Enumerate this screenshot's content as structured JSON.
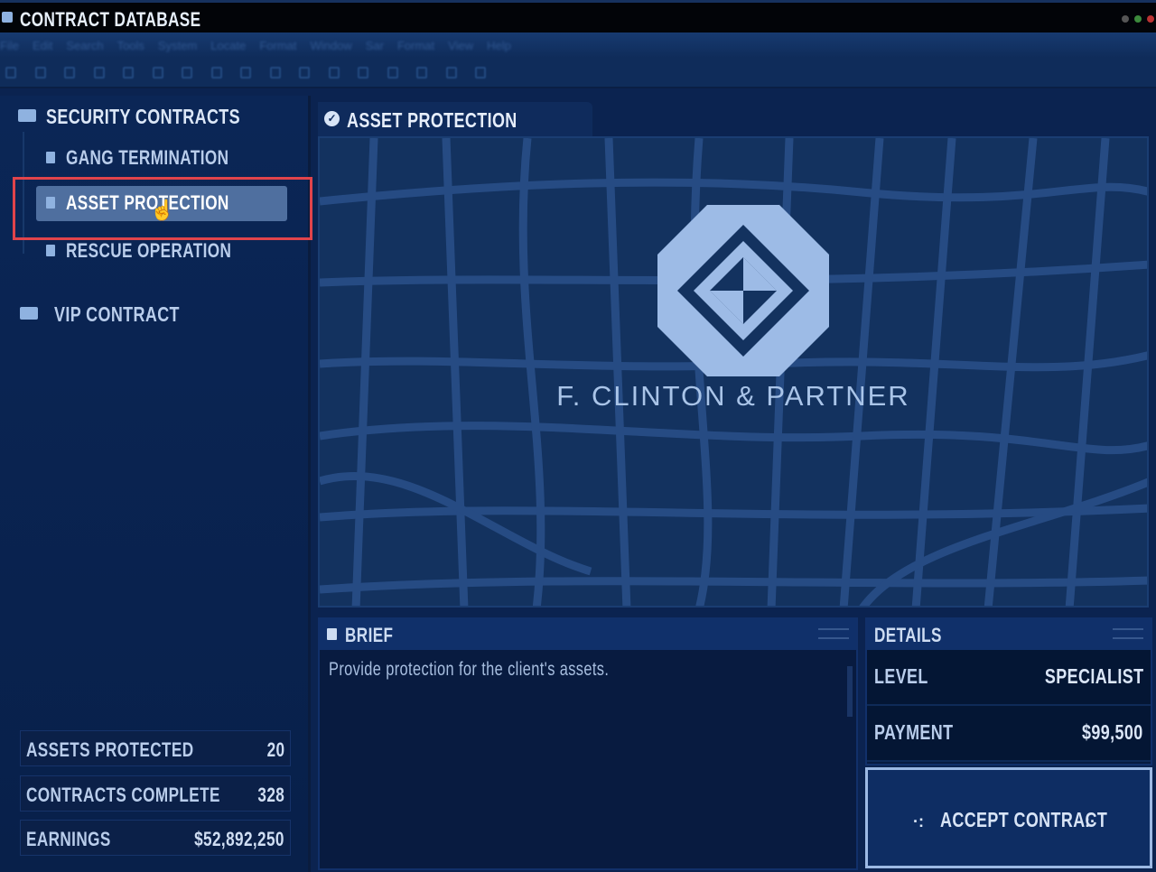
{
  "window": {
    "title": "CONTRACT DATABASE"
  },
  "menu": [
    "File",
    "Edit",
    "Search",
    "Tools",
    "System",
    "Locate",
    "Format",
    "Window",
    "Sar",
    "Format",
    "View",
    "Help"
  ],
  "sidebar": {
    "groups": [
      {
        "label": "SECURITY CONTRACTS",
        "icon": "folder-open-icon"
      },
      {
        "label": "VIP CONTRACT",
        "icon": "folder-icon"
      }
    ],
    "items": [
      {
        "label": "GANG TERMINATION",
        "selected": false
      },
      {
        "label": "ASSET PROTECTION",
        "selected": true
      },
      {
        "label": "RESCUE OPERATION",
        "selected": false
      }
    ],
    "stats": [
      {
        "label": "ASSETS PROTECTED",
        "value": "20"
      },
      {
        "label": "CONTRACTS COMPLETE",
        "value": "328"
      },
      {
        "label": "EARNINGS",
        "value": "$52,892,250"
      }
    ]
  },
  "main": {
    "tab_title": "ASSET PROTECTION",
    "logo_text": "F. CLINTON & PARTNER",
    "brief": {
      "title": "BRIEF",
      "text": "Provide protection for the client's assets."
    },
    "details": {
      "title": "DETAILS",
      "rows": [
        {
          "label": "LEVEL",
          "value": "SPECIALIST"
        },
        {
          "label": "PAYMENT",
          "value": "$99,500"
        }
      ]
    },
    "accept_label": "ACCEPT CONTRACT"
  },
  "colors": {
    "background": "#0b2350",
    "accent": "#8fb2e0",
    "highlight_box": "#e1444b",
    "selected_item": "#4f6f9f"
  }
}
